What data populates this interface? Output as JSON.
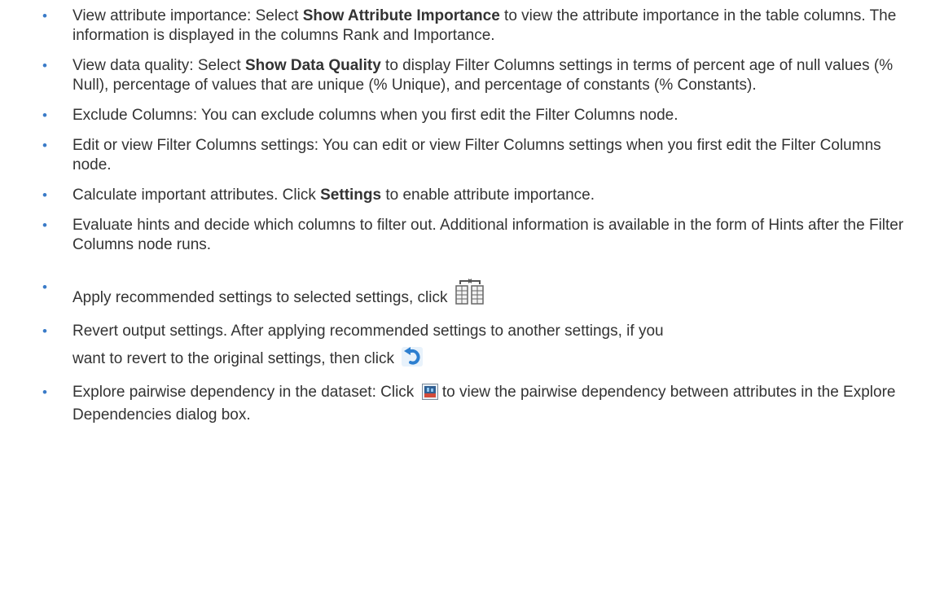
{
  "bullet_char": "•",
  "items": [
    {
      "prefix": "View attribute importance: Select ",
      "bold": "Show Attribute Importance",
      "suffix": " to view the attribute importance in the table columns. The information is displayed in the columns Rank and Importance."
    },
    {
      "prefix": "View data quality: Select ",
      "bold": "Show Data Quality",
      "suffix": " to display Filter Columns settings in terms of percent age of null values (% Null), percentage of values that are unique (% Unique), and percentage of constants (% Constants)."
    },
    {
      "text": "Exclude Columns: You can exclude columns when you first edit the Filter Columns node."
    },
    {
      "text": "Edit or view Filter Columns settings: You can edit or view Filter Columns settings when you first edit the Filter Columns node."
    },
    {
      "prefix": "Calculate important attributes. Click ",
      "bold": "Settings",
      "suffix": " to enable attribute importance."
    },
    {
      "text": "Evaluate hints and decide which columns to filter out. Additional information is available in the form of Hints after the Filter Columns node runs."
    },
    {
      "text": "Apply recommended settings to selected settings, click",
      "icon": "apply-recommended-settings-icon"
    },
    {
      "line1": "Revert output settings. After applying recommended settings to another settings, if you",
      "line2": "want to revert to the original settings, then click",
      "icon": "revert-icon"
    },
    {
      "prefix": "Explore pairwise dependency in the dataset: Click",
      "icon": "explore-dependencies-icon",
      "suffix": "to view the pairwise dependency between attributes in the Explore Dependencies dialog box."
    }
  ],
  "colors": {
    "text": "#333333",
    "bullet": "#3a7bc8"
  }
}
